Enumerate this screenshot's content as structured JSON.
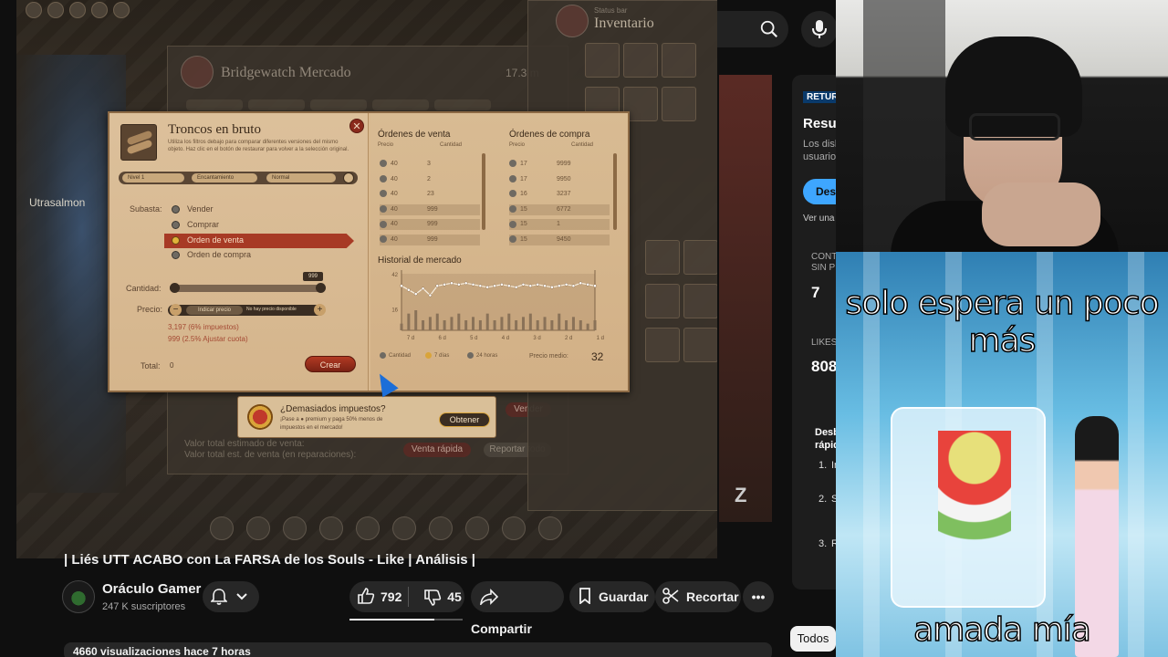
{
  "game": {
    "player_name": "Utrasalmon",
    "mercado_title": "Bridgewatch Mercado",
    "mercado_distance": "17.3 m",
    "mercado_footer1": "Valor total estimado de venta:",
    "mercado_footer2": "Valor total est. de venta (en reparaciones):",
    "btn_venta_rapida": "Venta rápida",
    "btn_reportar": "Reportar todo",
    "btn_vender": "Vender",
    "inventario_label": "Inventario",
    "inventario_small": "Status bar"
  },
  "dialog": {
    "item_title": "Troncos en bruto",
    "item_desc": "Utiliza los filtros debajo para comparar diferentes versiones del mismo objeto. Haz clic en el botón de restaurar para volver a la selección original.",
    "tier_select": "Nivel 1",
    "enchant_select": "Encantamiento",
    "quality_select": "Normal",
    "subasta_label": "Subasta:",
    "options": [
      "Vender",
      "Comprar",
      "Orden de venta",
      "Orden de compra"
    ],
    "selected_option": "Orden de venta",
    "cantidad_label": "Cantidad:",
    "cantidad_value": "999",
    "precio_label": "Precio:",
    "precio_placeholder": "Indicar precio",
    "precio_note": "No hay precio disponible",
    "tax_line1": "3,197 (6% impuestos)",
    "tax_line2": "999 (2.5% Ajustar cuota)",
    "total_label": "Total:",
    "total_value": "0",
    "crear_label": "Crear",
    "sell_orders_title": "Órdenes de venta",
    "buy_orders_title": "Órdenes de compra",
    "col_price": "Precio",
    "col_qty": "Cantidad",
    "sell_orders": [
      {
        "price": "40",
        "qty": "3"
      },
      {
        "price": "40",
        "qty": "2"
      },
      {
        "price": "40",
        "qty": "23"
      },
      {
        "price": "40",
        "qty": "999"
      },
      {
        "price": "40",
        "qty": "999"
      },
      {
        "price": "40",
        "qty": "999"
      }
    ],
    "buy_orders": [
      {
        "price": "17",
        "qty": "9999"
      },
      {
        "price": "17",
        "qty": "9950"
      },
      {
        "price": "16",
        "qty": "3237"
      },
      {
        "price": "15",
        "qty": "6772"
      },
      {
        "price": "15",
        "qty": "1"
      },
      {
        "price": "15",
        "qty": "9450"
      }
    ],
    "history_title": "Historial de mercado",
    "history_ymax": "42",
    "history_ymid": "16",
    "history_xticks": [
      "7 d",
      "6 d",
      "5 d",
      "4 d",
      "3 d",
      "2 d",
      "1 d"
    ],
    "history_prices": [
      33,
      30,
      27,
      31,
      26,
      33,
      34,
      35,
      34,
      35,
      34,
      33,
      32,
      33,
      34,
      33,
      32,
      34,
      33,
      34,
      33,
      32,
      33,
      34,
      33,
      35,
      34,
      33
    ],
    "history_volume": [
      2,
      5,
      6,
      3,
      4,
      5,
      3,
      4,
      5,
      3,
      4,
      3,
      5,
      3,
      4,
      5,
      3,
      4,
      5,
      3,
      4,
      3,
      5,
      3,
      4,
      3,
      2,
      3
    ],
    "legend_items": [
      "Cantidad",
      "7 días",
      "24 horas"
    ],
    "avg_label": "Precio medio:",
    "avg_value": "32"
  },
  "tooltip": {
    "question": "¿Demasiados impuestos?",
    "line1": "¡Pase a ● premium y paga 50% menos de",
    "line2": "impuestos en el mercado!",
    "button": "Obtener"
  },
  "youtube": {
    "video_title": "| Liés UTT ACABO con La FARSA de los Souls - Like | Análisis |",
    "channel_name": "Oráculo Gamer",
    "channel_subs": "247 K suscriptores",
    "likes": "792",
    "dislikes": "45",
    "share_label": "Compartir",
    "save_label": "Guardar",
    "clip_label": "Recortar",
    "more_label": "•••",
    "views_line": "4660 visualizaciones  hace 7 horas",
    "progress_fraction": 0.75,
    "todos_label": "Todos"
  },
  "sidebar": {
    "badge": "RETUR",
    "heading": "Resum",
    "text1": "Los disli",
    "text2": "usuarios",
    "desb_button": "Desb",
    "ver_una": "Ver una v",
    "cont_label": "CONT",
    "sin_label": "SIN P",
    "count1": "7",
    "likes_label": "LIKES",
    "likes_val": "808",
    "desb_head1": "Desb",
    "desb_head2": "rápid",
    "list_nums": [
      "1.",
      "2.",
      "3."
    ],
    "list_letters": [
      "In",
      "S",
      "R"
    ]
  },
  "meme": {
    "top_text": "solo espera un poco más",
    "bottom_text": "amada mía"
  },
  "colors": {
    "accent_blue": "#3ea6ff",
    "crear_red": "#b23a24",
    "yt_bg": "#0f0f0f"
  }
}
